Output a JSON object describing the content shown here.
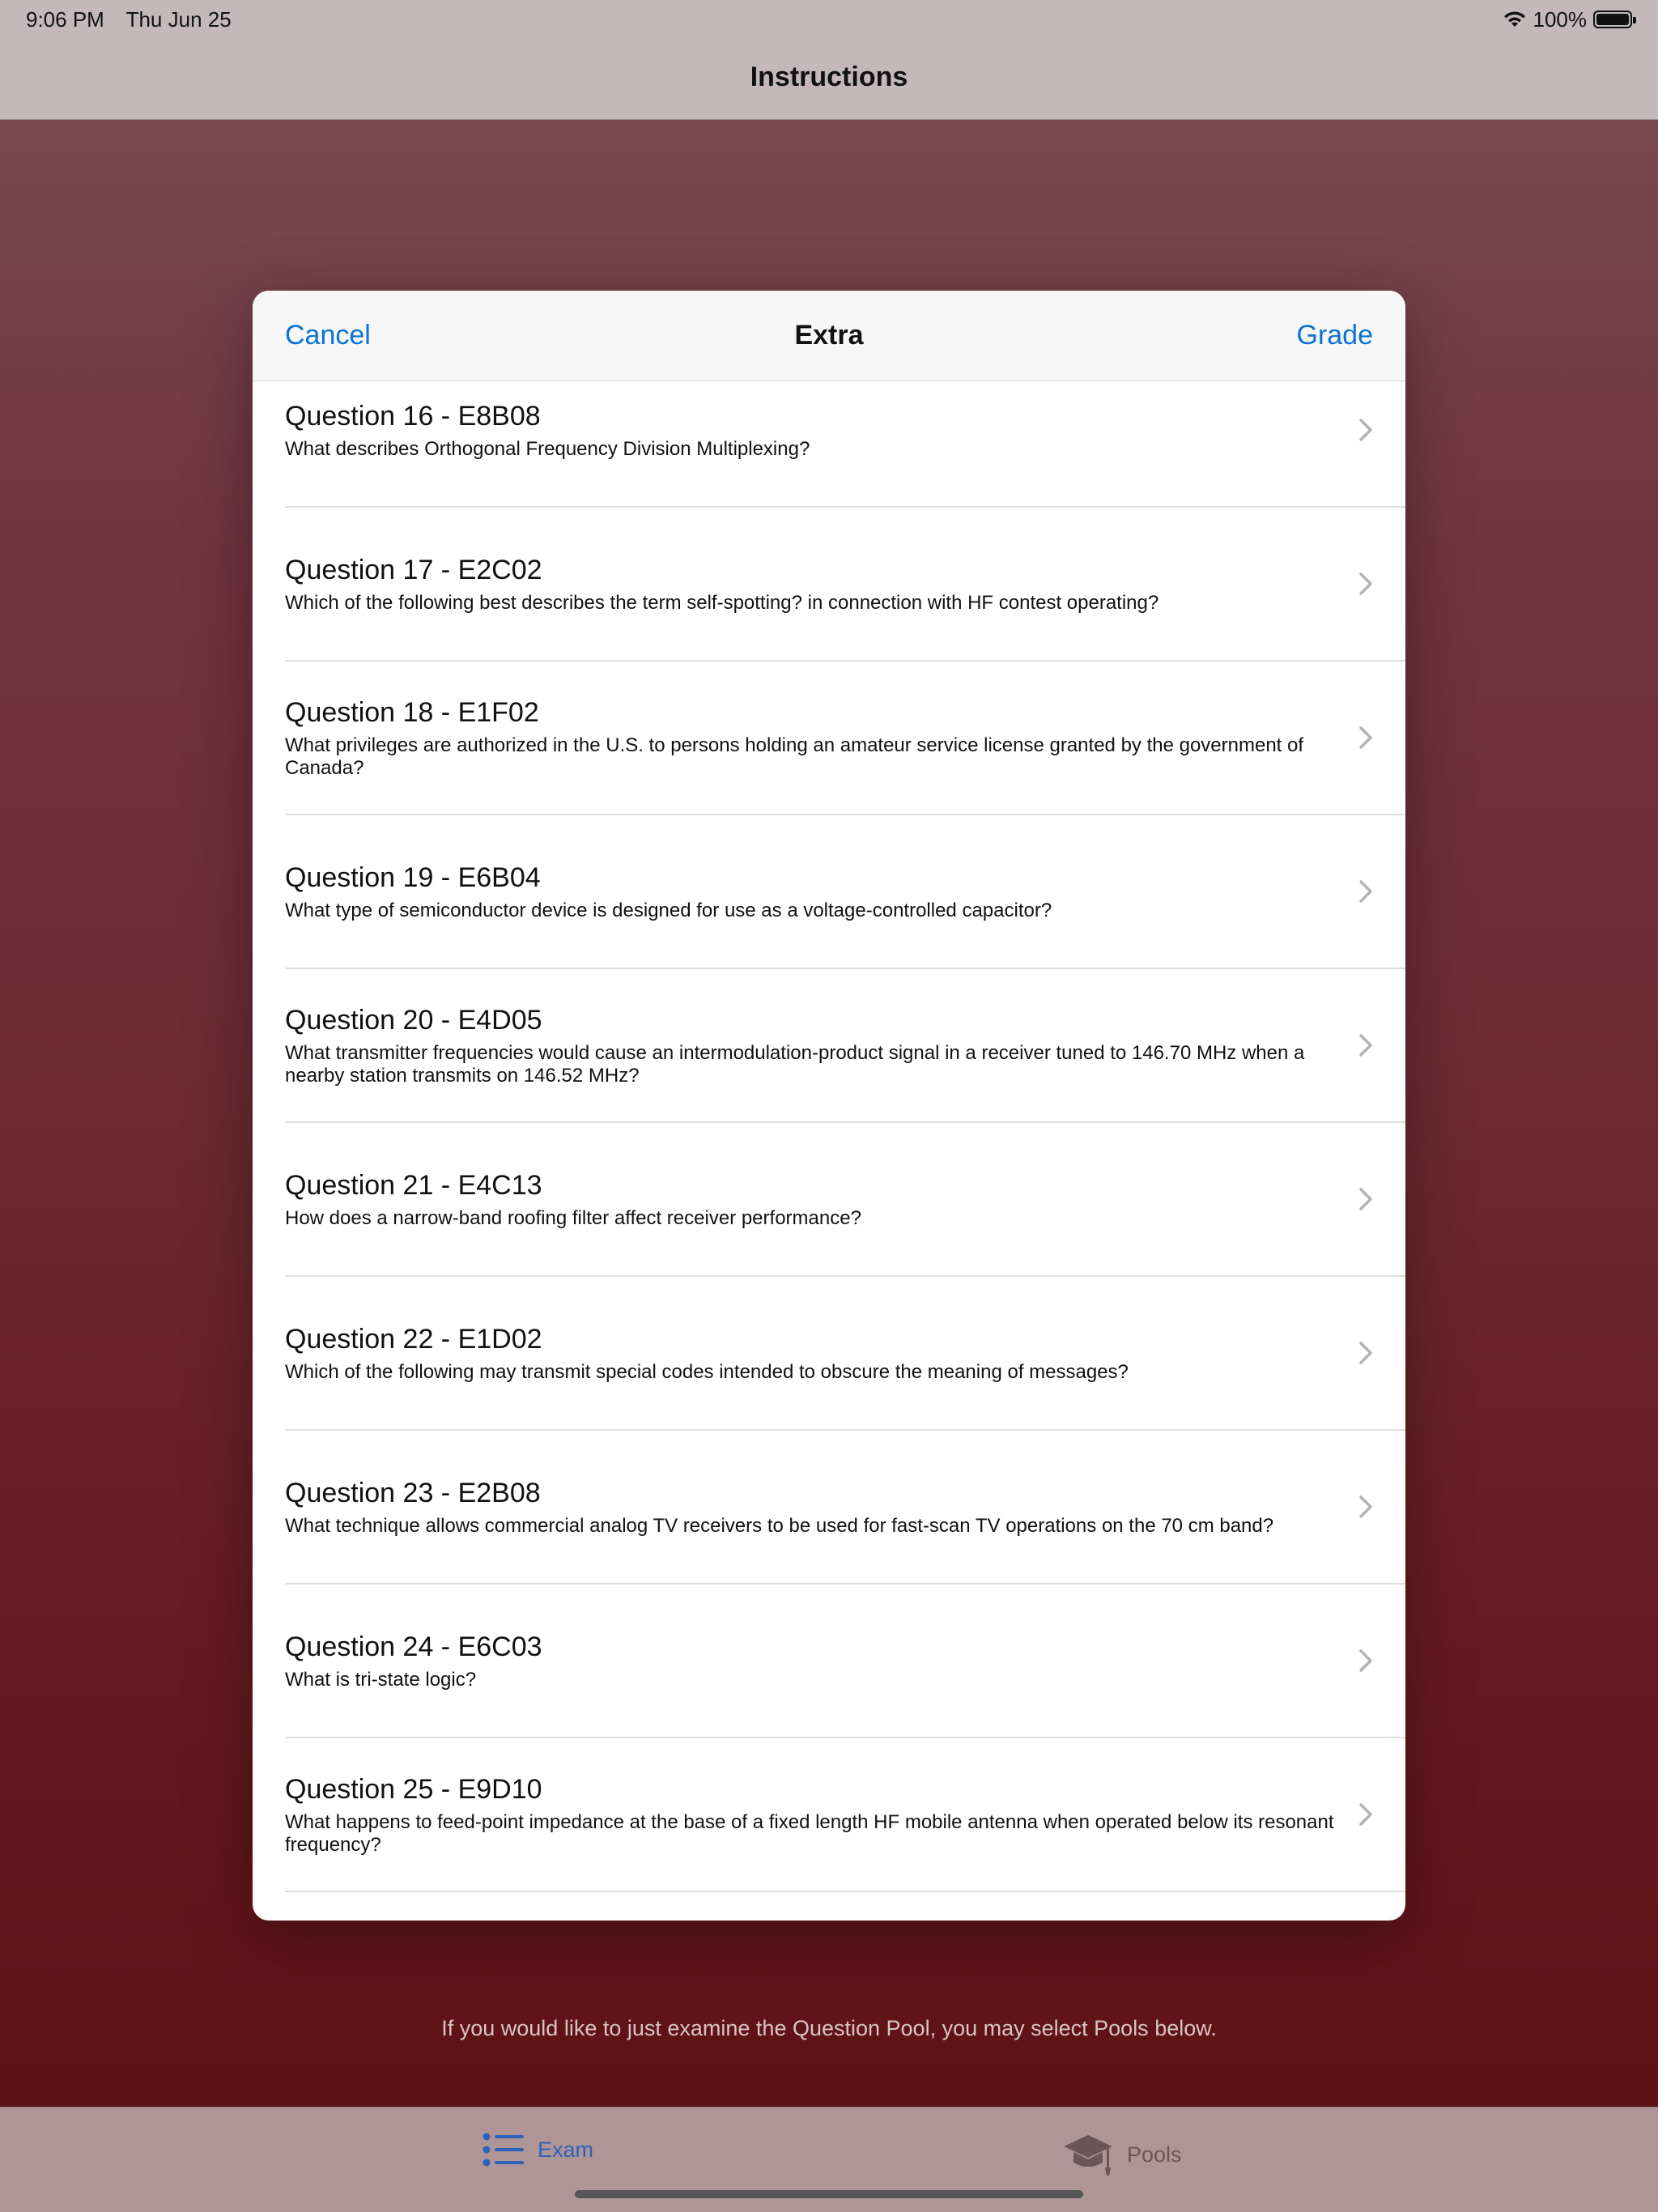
{
  "status_bar": {
    "time": "9:06 PM",
    "date": "Thu Jun 25",
    "battery_percent": "100%"
  },
  "top_nav": {
    "title": "Instructions"
  },
  "modal": {
    "title": "Extra",
    "cancel_label": "Cancel",
    "grade_label": "Grade",
    "questions": [
      {
        "title": "Question 16 - E8B08",
        "text": "What describes Orthogonal Frequency Division Multiplexing?"
      },
      {
        "title": "Question 17 - E2C02",
        "text": "Which of the following best describes the term self-spotting? in connection with HF contest operating?"
      },
      {
        "title": "Question 18 - E1F02",
        "text": "What privileges are authorized in the U.S. to persons holding an amateur service license granted by the government of Canada?"
      },
      {
        "title": "Question 19 - E6B04",
        "text": "What type of semiconductor device is designed for use as a voltage-controlled capacitor?"
      },
      {
        "title": "Question 20 - E4D05",
        "text": "What transmitter frequencies would cause an intermodulation-product signal in a receiver tuned to 146.70 MHz when a nearby station transmits on 146.52 MHz?"
      },
      {
        "title": "Question 21 - E4C13",
        "text": "How does a narrow-band roofing filter affect receiver performance?"
      },
      {
        "title": "Question 22 - E1D02",
        "text": "Which of the following may transmit special codes intended to obscure the meaning of messages?"
      },
      {
        "title": "Question 23 - E2B08",
        "text": "What technique allows commercial analog TV receivers to be used for fast-scan TV operations on the 70 cm band?"
      },
      {
        "title": "Question 24 - E6C03",
        "text": "What is tri-state logic?"
      },
      {
        "title": "Question 25 - E9D10",
        "text": "What happens to feed-point impedance at the base of a fixed length HF mobile antenna when operated below its resonant frequency?"
      }
    ]
  },
  "info_text": "If you would like to just examine the Question Pool, you may select Pools below.",
  "tab_bar": {
    "tabs": [
      {
        "label": "Exam",
        "icon": "list-icon",
        "selected": true
      },
      {
        "label": "Pools",
        "icon": "graduation-cap-icon",
        "selected": false
      }
    ]
  },
  "colors": {
    "accent": "#0a72d6",
    "tab_selected": "#2a63b9"
  }
}
